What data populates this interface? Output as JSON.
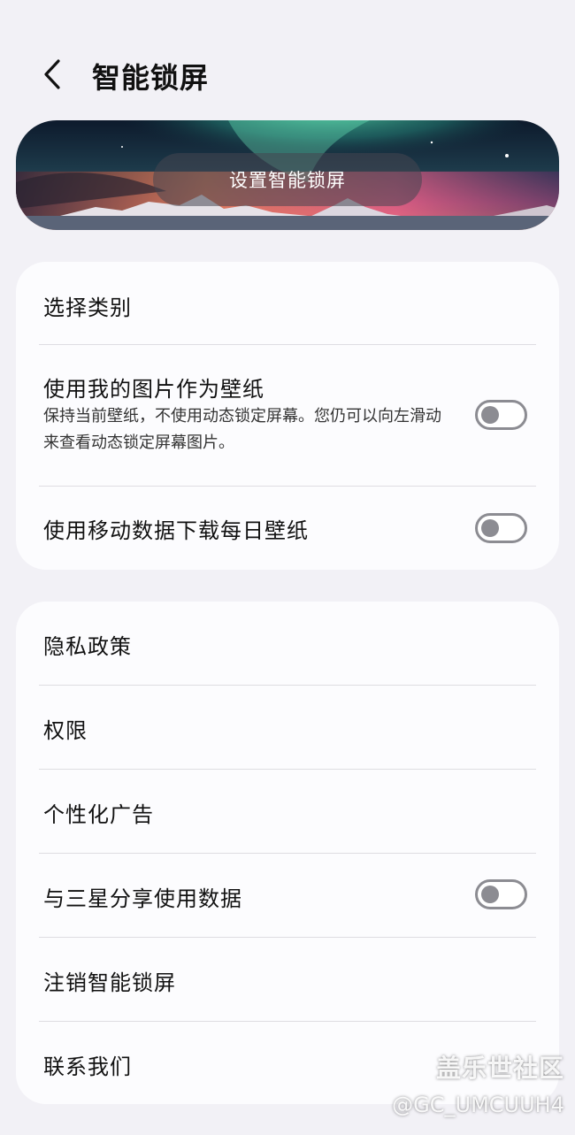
{
  "header": {
    "title": "智能锁屏"
  },
  "banner": {
    "button_label": "设置智能锁屏"
  },
  "settings_card": {
    "select_category": "选择类别",
    "use_my_images": {
      "label": "使用我的图片作为壁纸",
      "description": "保持当前壁纸，不使用动态锁定屏幕。您仍可以向左滑动来查看动态锁定屏幕图片。",
      "enabled": false
    },
    "mobile_data_download": {
      "label": "使用移动数据下载每日壁纸",
      "enabled": false
    }
  },
  "info_card": {
    "privacy_policy": "隐私政策",
    "permissions": "权限",
    "personalized_ads": "个性化广告",
    "share_with_samsung": {
      "label": "与三星分享使用数据",
      "enabled": false
    },
    "unsubscribe": "注销智能锁屏",
    "contact_us": "联系我们"
  },
  "watermark": {
    "line1": "盖乐世社区",
    "line2": "@GC_UMCUUH4"
  },
  "colors": {
    "background": "#f2f1f6",
    "card": "#fcfcfe",
    "toggle_off": "#8c8c92"
  }
}
